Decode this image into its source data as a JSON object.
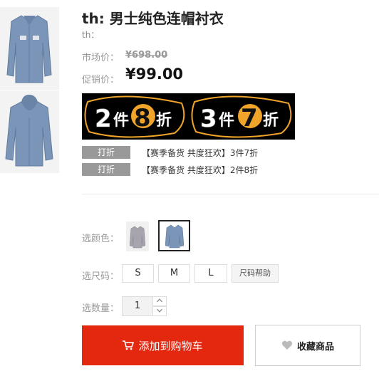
{
  "product": {
    "title": "th: 男士纯色连帽衬衣",
    "subtitle": "th："
  },
  "price": {
    "market_label": "市场价：",
    "market_value": "¥698.00",
    "promo_label": "促销价：",
    "promo_value": "¥99.00"
  },
  "banner": {
    "left_num": "2",
    "left_word1": "件",
    "left_highlight": "8",
    "left_word2": "折",
    "right_num": "3",
    "right_word1": "件",
    "right_highlight": "7",
    "right_word2": "折"
  },
  "promotions": [
    {
      "tag": "打折",
      "text": "【赛季备货 共度狂欢】3件7折"
    },
    {
      "tag": "打折",
      "text": "【赛季备货 共度狂欢】2件8折"
    }
  ],
  "options": {
    "color_label": "选颜色：",
    "size_label": "选尺码：",
    "sizes": [
      "S",
      "M",
      "L"
    ],
    "size_help": "尺码帮助",
    "qty_label": "选数量：",
    "qty_value": "1",
    "qty_up": "^",
    "qty_down": "v"
  },
  "actions": {
    "add_to_cart": "添加到购物车",
    "favorite": "收藏商品"
  },
  "colors": {
    "accent": "#e4280f",
    "tag_bg": "#999999",
    "shirt_blue": "#7b95b8",
    "shirt_grey": "#a7a4ad",
    "banner_orange": "#f0a52a"
  },
  "icons": [
    "shirt-icon",
    "cart-icon",
    "heart-icon",
    "chevron-up-icon",
    "chevron-down-icon"
  ]
}
